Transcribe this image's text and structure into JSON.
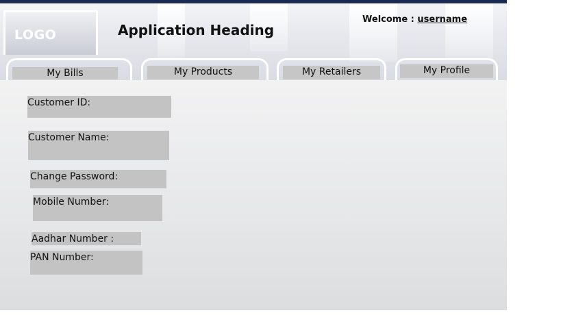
{
  "header": {
    "logo": "LOGO",
    "title": "Application Heading",
    "welcome_label": "Welcome :",
    "username": "username"
  },
  "tabs": [
    {
      "label": "My Bills"
    },
    {
      "label": "My Products"
    },
    {
      "label": "My Retailers"
    },
    {
      "label": "My Profile"
    }
  ],
  "profile_form": {
    "customer_id": "Customer ID:",
    "customer_name": "Customer Name:",
    "change_password": "Change Password:",
    "mobile_number": "Mobile Number:",
    "aadhar_number": "Aadhar Number :",
    "pan_number": "PAN Number:"
  }
}
